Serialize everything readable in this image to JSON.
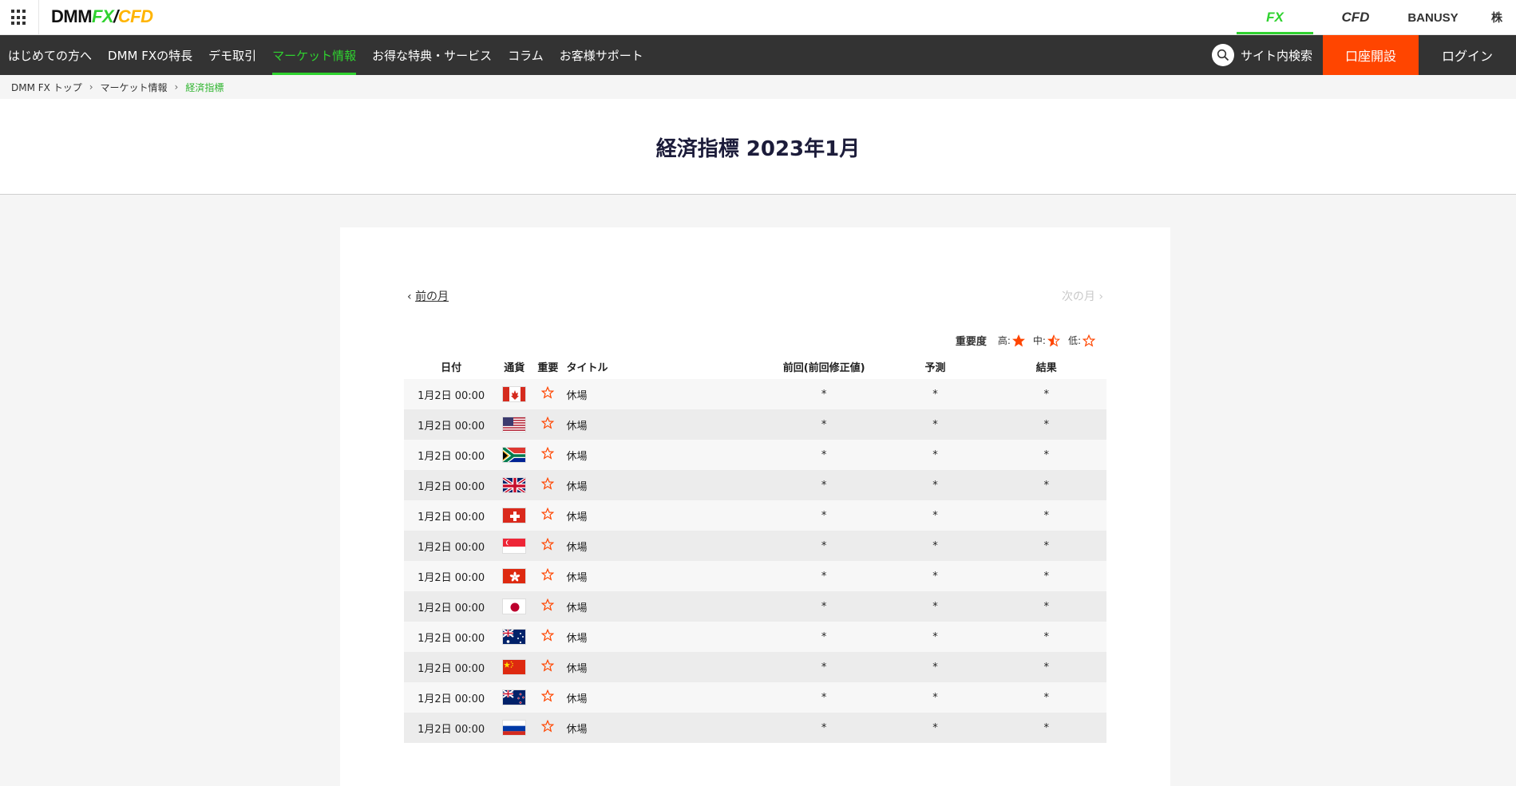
{
  "header": {
    "logo": {
      "dmm": "DMM",
      "fx": "FX",
      "slash": "/",
      "cfd": "CFD"
    },
    "tabs": [
      {
        "label": "FX",
        "active": true
      },
      {
        "label": "CFD",
        "active": false
      },
      {
        "label": "BANUSY",
        "active": false
      },
      {
        "label": "株",
        "active": false
      }
    ]
  },
  "nav": {
    "items": [
      {
        "label": "はじめての方へ",
        "active": false
      },
      {
        "label": "DMM FXの特長",
        "active": false
      },
      {
        "label": "デモ取引",
        "active": false
      },
      {
        "label": "マーケット情報",
        "active": true
      },
      {
        "label": "お得な特典・サービス",
        "active": false
      },
      {
        "label": "コラム",
        "active": false
      },
      {
        "label": "お客様サポート",
        "active": false
      }
    ],
    "search_label": "サイト内検索",
    "open_account": "口座開設",
    "login": "ログイン"
  },
  "breadcrumb": {
    "items": [
      "DMM FX トップ",
      "マーケット情報"
    ],
    "separator": "›",
    "current": "経済指標"
  },
  "page_title": "経済指標 2023年1月",
  "pager": {
    "prev_arrow": "‹",
    "prev": "前の月",
    "next": "次の月",
    "next_arrow": "›"
  },
  "legend": {
    "label": "重要度",
    "high": "高:",
    "mid": "中:",
    "low": "低:"
  },
  "table": {
    "headers": [
      "日付",
      "通貨",
      "重要",
      "タイトル",
      "前回(前回修正値)",
      "予測",
      "結果"
    ],
    "rows": [
      {
        "date": "1月2日 00:00",
        "flag": "canada-flag",
        "importance": "low",
        "title": "休場",
        "prev": "*",
        "forecast": "*",
        "result": "*"
      },
      {
        "date": "1月2日 00:00",
        "flag": "us-flag",
        "importance": "low",
        "title": "休場",
        "prev": "*",
        "forecast": "*",
        "result": "*"
      },
      {
        "date": "1月2日 00:00",
        "flag": "south-africa-flag",
        "importance": "low",
        "title": "休場",
        "prev": "*",
        "forecast": "*",
        "result": "*"
      },
      {
        "date": "1月2日 00:00",
        "flag": "uk-flag",
        "importance": "low",
        "title": "休場",
        "prev": "*",
        "forecast": "*",
        "result": "*"
      },
      {
        "date": "1月2日 00:00",
        "flag": "switzerland-flag",
        "importance": "low",
        "title": "休場",
        "prev": "*",
        "forecast": "*",
        "result": "*"
      },
      {
        "date": "1月2日 00:00",
        "flag": "singapore-flag",
        "importance": "low",
        "title": "休場",
        "prev": "*",
        "forecast": "*",
        "result": "*"
      },
      {
        "date": "1月2日 00:00",
        "flag": "hong-kong-flag",
        "importance": "low",
        "title": "休場",
        "prev": "*",
        "forecast": "*",
        "result": "*"
      },
      {
        "date": "1月2日 00:00",
        "flag": "japan-flag",
        "importance": "low",
        "title": "休場",
        "prev": "*",
        "forecast": "*",
        "result": "*"
      },
      {
        "date": "1月2日 00:00",
        "flag": "australia-flag",
        "importance": "low",
        "title": "休場",
        "prev": "*",
        "forecast": "*",
        "result": "*"
      },
      {
        "date": "1月2日 00:00",
        "flag": "china-flag",
        "importance": "low",
        "title": "休場",
        "prev": "*",
        "forecast": "*",
        "result": "*"
      },
      {
        "date": "1月2日 00:00",
        "flag": "new-zealand-flag",
        "importance": "low",
        "title": "休場",
        "prev": "*",
        "forecast": "*",
        "result": "*"
      },
      {
        "date": "1月2日 00:00",
        "flag": "russia-flag",
        "importance": "low",
        "title": "休場",
        "prev": "*",
        "forecast": "*",
        "result": "*"
      }
    ]
  },
  "colors": {
    "accent": "#2fd22f",
    "cta": "#ff4500",
    "star": "#ff4500",
    "nav_bg": "#333333"
  }
}
